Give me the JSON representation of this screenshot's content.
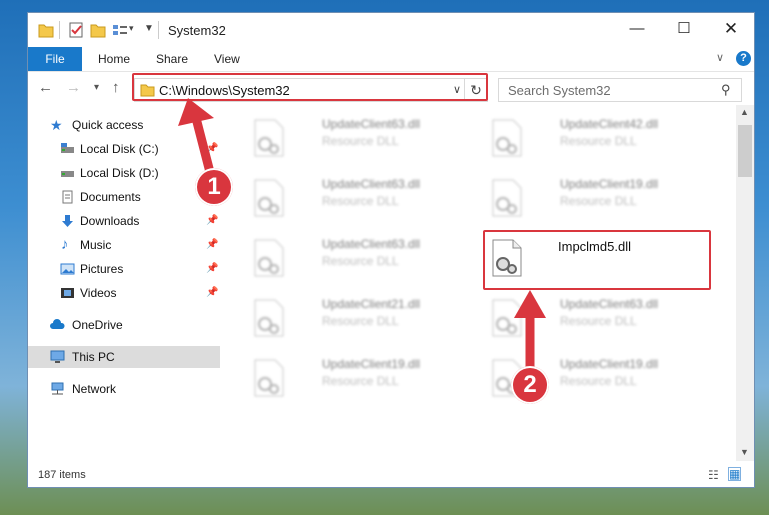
{
  "window": {
    "title": "System32"
  },
  "ribbon": {
    "tabs": [
      "File",
      "Home",
      "Share",
      "View"
    ]
  },
  "nav": {
    "address": "C:\\Windows\\System32",
    "search_placeholder": "Search System32"
  },
  "sidebar": {
    "items": [
      {
        "label": "Quick access",
        "icon": "star-icon"
      },
      {
        "label": "Local Disk (C:)",
        "icon": "drive-icon"
      },
      {
        "label": "Local Disk (D:)",
        "icon": "drive-icon"
      },
      {
        "label": "Documents",
        "icon": "documents-icon"
      },
      {
        "label": "Downloads",
        "icon": "download-icon"
      },
      {
        "label": "Music",
        "icon": "music-icon"
      },
      {
        "label": "Pictures",
        "icon": "pictures-icon"
      },
      {
        "label": "Videos",
        "icon": "videos-icon"
      },
      {
        "label": "OneDrive",
        "icon": "cloud-icon"
      },
      {
        "label": "This PC",
        "icon": "computer-icon"
      },
      {
        "label": "Network",
        "icon": "network-icon"
      }
    ]
  },
  "files": [
    {
      "name": "UpdateClient63.dll",
      "type": "Resource DLL"
    },
    {
      "name": "UpdateClient42.dll",
      "type": "Resource DLL"
    },
    {
      "name": "UpdateClient63.dll",
      "type": "Resource DLL"
    },
    {
      "name": "UpdateClient19.dll",
      "type": "Resource DLL"
    },
    {
      "name": "UpdateClient63.dll",
      "type": "Resource DLL"
    },
    {
      "name": "Impclmd5.dll",
      "type": ""
    },
    {
      "name": "UpdateClient21.dll",
      "type": "Resource DLL"
    },
    {
      "name": "UpdateClient63.dll",
      "type": "Resource DLL"
    },
    {
      "name": "UpdateClient19.dll",
      "type": "Resource DLL"
    },
    {
      "name": "UpdateClient19.dll",
      "type": "Resource DLL"
    }
  ],
  "status": {
    "item_count": "187 items"
  },
  "callouts": [
    "1",
    "2"
  ],
  "colors": {
    "accent": "#1979ca",
    "highlight": "#d9363e"
  }
}
